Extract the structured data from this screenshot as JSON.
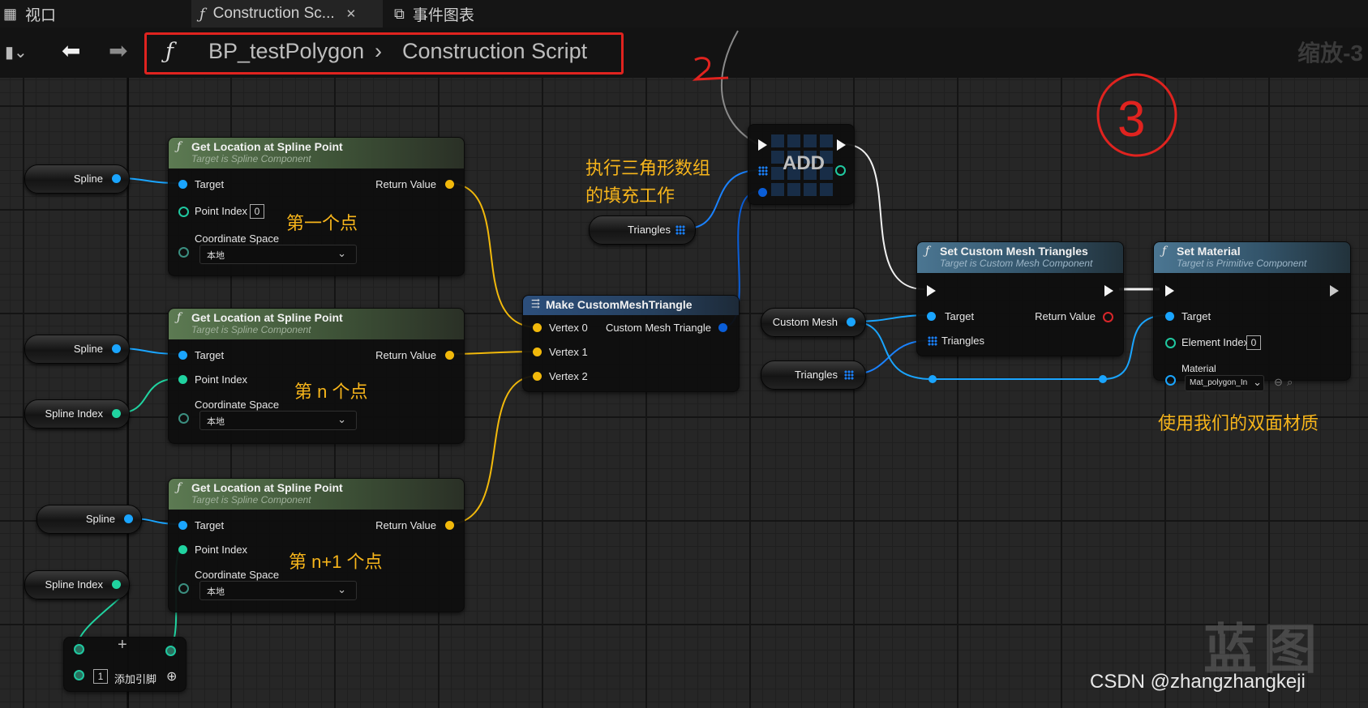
{
  "tabs": [
    {
      "label": "视口",
      "icon": "viewport-grid-icon"
    },
    {
      "label": "Construction Sc...",
      "icon": "function-icon",
      "active": true
    },
    {
      "label": "事件图表",
      "icon": "event-graph-icon"
    }
  ],
  "breadcrumb": {
    "blueprint": "BP_testPolygon",
    "separator": "›",
    "graph": "Construction Script"
  },
  "zoom": "缩放-3",
  "nodes": {
    "get_loc_1": {
      "title": "Get Location at Spline Point",
      "subtitle": "Target is Spline Component",
      "target": "Target",
      "return": "Return Value",
      "point_index_label": "Point Index",
      "point_index_value": "0",
      "coord_label": "Coordinate Space",
      "coord_value": "本地"
    },
    "get_loc_2": {
      "title": "Get Location at Spline Point",
      "subtitle": "Target is Spline Component",
      "target": "Target",
      "return": "Return Value",
      "point_index_label": "Point Index",
      "coord_label": "Coordinate Space",
      "coord_value": "本地"
    },
    "get_loc_3": {
      "title": "Get Location at Spline Point",
      "subtitle": "Target is Spline Component",
      "target": "Target",
      "return": "Return Value",
      "point_index_label": "Point Index",
      "coord_label": "Coordinate Space",
      "coord_value": "本地"
    },
    "make_tri": {
      "title": "Make CustomMeshTriangle",
      "v0": "Vertex 0",
      "v1": "Vertex 1",
      "v2": "Vertex 2",
      "out": "Custom Mesh Triangle"
    },
    "add": {
      "title": "ADD"
    },
    "set_tris": {
      "title": "Set Custom Mesh Triangles",
      "subtitle": "Target is Custom Mesh Component",
      "target": "Target",
      "triangles": "Triangles",
      "return": "Return Value"
    },
    "set_mat": {
      "title": "Set Material",
      "subtitle": "Target is Primitive Component",
      "target": "Target",
      "element_index_label": "Element Index",
      "element_index_value": "0",
      "material_label": "Material",
      "material_value": "Mat_polygon_In"
    },
    "add_pin": {
      "count": "1",
      "label": "添加引脚"
    }
  },
  "variables": {
    "spline": "Spline",
    "spline_index": "Spline Index",
    "triangles": "Triangles",
    "custom_mesh": "Custom Mesh"
  },
  "annotations": {
    "first_point": "第一个点",
    "nth_point": "第 n 个点",
    "n1_point": "第 n+1 个点",
    "fill_line1": "执行三角形数组",
    "fill_line2": "的填充工作",
    "material_note": "使用我们的双面材质",
    "step_number": "3",
    "mark_2": "2"
  },
  "watermark": {
    "csdn": "CSDN @zhangzhangkeji",
    "logo": "蓝图"
  },
  "colors": {
    "exec": "#f5f5f5",
    "vector": "#f2b90b",
    "object": "#1aa5ff",
    "int": "#20d3a0",
    "highlight": "#e0231f",
    "annotation": "#f7b51b"
  }
}
